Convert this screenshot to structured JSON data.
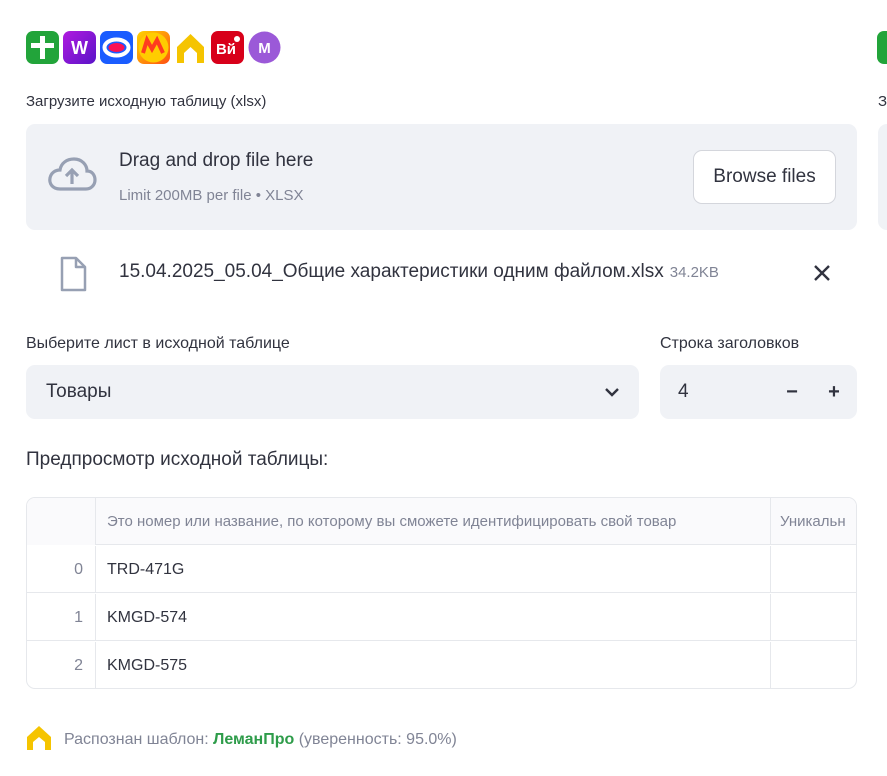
{
  "logos": [
    {
      "name": "plus-logo-icon",
      "color": "#22a43a"
    },
    {
      "name": "wildberries-logo-icon",
      "color": "#8b13d6",
      "letter": "W"
    },
    {
      "name": "ozon-logo-icon",
      "color": "#1a5cff"
    },
    {
      "name": "yandex-market-logo-icon",
      "color": "#ffcc00",
      "letter": "M"
    },
    {
      "name": "lemanpro-logo-icon",
      "color": "#f5c400"
    },
    {
      "name": "vseinstrumenti-logo-icon",
      "color": "#d8001a",
      "letter": "Вй"
    },
    {
      "name": "megamarket-logo-icon",
      "color": "#9b59d8",
      "letter": "M"
    }
  ],
  "upload": {
    "label": "Загрузите исходную таблицу (xlsx)",
    "label_right": "З",
    "drop_title": "Drag and drop file here",
    "drop_subtitle": "Limit 200MB per file • XLSX",
    "browse_label": "Browse files"
  },
  "file": {
    "name": "15.04.2025_05.04_Общие характеристики одним файлом.xlsx",
    "size": "34.2KB"
  },
  "sheet": {
    "label": "Выберите лист в исходной таблице",
    "value": "Товары"
  },
  "header_row": {
    "label": "Строка заголовков",
    "value": "4",
    "minus": "−",
    "plus": "+"
  },
  "preview": {
    "title": "Предпросмотр исходной таблицы:",
    "columns": [
      "",
      "Это номер или название, по которому вы сможете идентифицировать свой товар",
      "Уникальн"
    ],
    "rows": [
      {
        "index": "0",
        "a": "TRD-471G",
        "b": ""
      },
      {
        "index": "1",
        "a": "KMGD-574",
        "b": ""
      },
      {
        "index": "2",
        "a": "KMGD-575",
        "b": ""
      }
    ]
  },
  "template": {
    "prefix": "Распознан шаблон: ",
    "name": "ЛеманПро",
    "suffix": " (уверенность: 95.0%)"
  }
}
